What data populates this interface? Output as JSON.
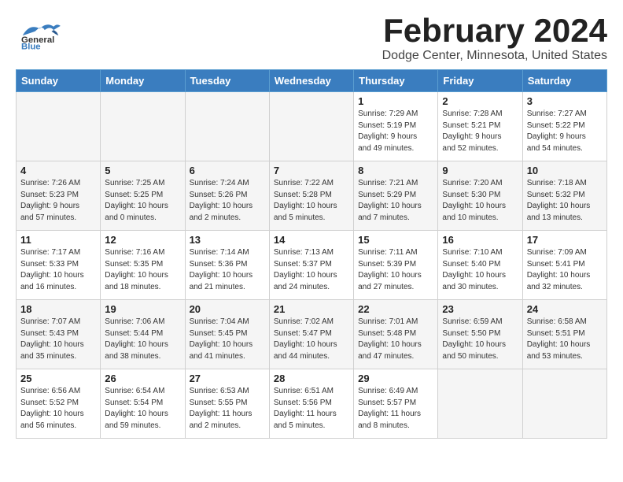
{
  "header": {
    "logo_line1": "General",
    "logo_line2": "Blue",
    "title": "February 2024",
    "location": "Dodge Center, Minnesota, United States"
  },
  "weekdays": [
    "Sunday",
    "Monday",
    "Tuesday",
    "Wednesday",
    "Thursday",
    "Friday",
    "Saturday"
  ],
  "weeks": [
    [
      {
        "day": "",
        "info": ""
      },
      {
        "day": "",
        "info": ""
      },
      {
        "day": "",
        "info": ""
      },
      {
        "day": "",
        "info": ""
      },
      {
        "day": "1",
        "info": "Sunrise: 7:29 AM\nSunset: 5:19 PM\nDaylight: 9 hours\nand 49 minutes."
      },
      {
        "day": "2",
        "info": "Sunrise: 7:28 AM\nSunset: 5:21 PM\nDaylight: 9 hours\nand 52 minutes."
      },
      {
        "day": "3",
        "info": "Sunrise: 7:27 AM\nSunset: 5:22 PM\nDaylight: 9 hours\nand 54 minutes."
      }
    ],
    [
      {
        "day": "4",
        "info": "Sunrise: 7:26 AM\nSunset: 5:23 PM\nDaylight: 9 hours\nand 57 minutes."
      },
      {
        "day": "5",
        "info": "Sunrise: 7:25 AM\nSunset: 5:25 PM\nDaylight: 10 hours\nand 0 minutes."
      },
      {
        "day": "6",
        "info": "Sunrise: 7:24 AM\nSunset: 5:26 PM\nDaylight: 10 hours\nand 2 minutes."
      },
      {
        "day": "7",
        "info": "Sunrise: 7:22 AM\nSunset: 5:28 PM\nDaylight: 10 hours\nand 5 minutes."
      },
      {
        "day": "8",
        "info": "Sunrise: 7:21 AM\nSunset: 5:29 PM\nDaylight: 10 hours\nand 7 minutes."
      },
      {
        "day": "9",
        "info": "Sunrise: 7:20 AM\nSunset: 5:30 PM\nDaylight: 10 hours\nand 10 minutes."
      },
      {
        "day": "10",
        "info": "Sunrise: 7:18 AM\nSunset: 5:32 PM\nDaylight: 10 hours\nand 13 minutes."
      }
    ],
    [
      {
        "day": "11",
        "info": "Sunrise: 7:17 AM\nSunset: 5:33 PM\nDaylight: 10 hours\nand 16 minutes."
      },
      {
        "day": "12",
        "info": "Sunrise: 7:16 AM\nSunset: 5:35 PM\nDaylight: 10 hours\nand 18 minutes."
      },
      {
        "day": "13",
        "info": "Sunrise: 7:14 AM\nSunset: 5:36 PM\nDaylight: 10 hours\nand 21 minutes."
      },
      {
        "day": "14",
        "info": "Sunrise: 7:13 AM\nSunset: 5:37 PM\nDaylight: 10 hours\nand 24 minutes."
      },
      {
        "day": "15",
        "info": "Sunrise: 7:11 AM\nSunset: 5:39 PM\nDaylight: 10 hours\nand 27 minutes."
      },
      {
        "day": "16",
        "info": "Sunrise: 7:10 AM\nSunset: 5:40 PM\nDaylight: 10 hours\nand 30 minutes."
      },
      {
        "day": "17",
        "info": "Sunrise: 7:09 AM\nSunset: 5:41 PM\nDaylight: 10 hours\nand 32 minutes."
      }
    ],
    [
      {
        "day": "18",
        "info": "Sunrise: 7:07 AM\nSunset: 5:43 PM\nDaylight: 10 hours\nand 35 minutes."
      },
      {
        "day": "19",
        "info": "Sunrise: 7:06 AM\nSunset: 5:44 PM\nDaylight: 10 hours\nand 38 minutes."
      },
      {
        "day": "20",
        "info": "Sunrise: 7:04 AM\nSunset: 5:45 PM\nDaylight: 10 hours\nand 41 minutes."
      },
      {
        "day": "21",
        "info": "Sunrise: 7:02 AM\nSunset: 5:47 PM\nDaylight: 10 hours\nand 44 minutes."
      },
      {
        "day": "22",
        "info": "Sunrise: 7:01 AM\nSunset: 5:48 PM\nDaylight: 10 hours\nand 47 minutes."
      },
      {
        "day": "23",
        "info": "Sunrise: 6:59 AM\nSunset: 5:50 PM\nDaylight: 10 hours\nand 50 minutes."
      },
      {
        "day": "24",
        "info": "Sunrise: 6:58 AM\nSunset: 5:51 PM\nDaylight: 10 hours\nand 53 minutes."
      }
    ],
    [
      {
        "day": "25",
        "info": "Sunrise: 6:56 AM\nSunset: 5:52 PM\nDaylight: 10 hours\nand 56 minutes."
      },
      {
        "day": "26",
        "info": "Sunrise: 6:54 AM\nSunset: 5:54 PM\nDaylight: 10 hours\nand 59 minutes."
      },
      {
        "day": "27",
        "info": "Sunrise: 6:53 AM\nSunset: 5:55 PM\nDaylight: 11 hours\nand 2 minutes."
      },
      {
        "day": "28",
        "info": "Sunrise: 6:51 AM\nSunset: 5:56 PM\nDaylight: 11 hours\nand 5 minutes."
      },
      {
        "day": "29",
        "info": "Sunrise: 6:49 AM\nSunset: 5:57 PM\nDaylight: 11 hours\nand 8 minutes."
      },
      {
        "day": "",
        "info": ""
      },
      {
        "day": "",
        "info": ""
      }
    ]
  ]
}
